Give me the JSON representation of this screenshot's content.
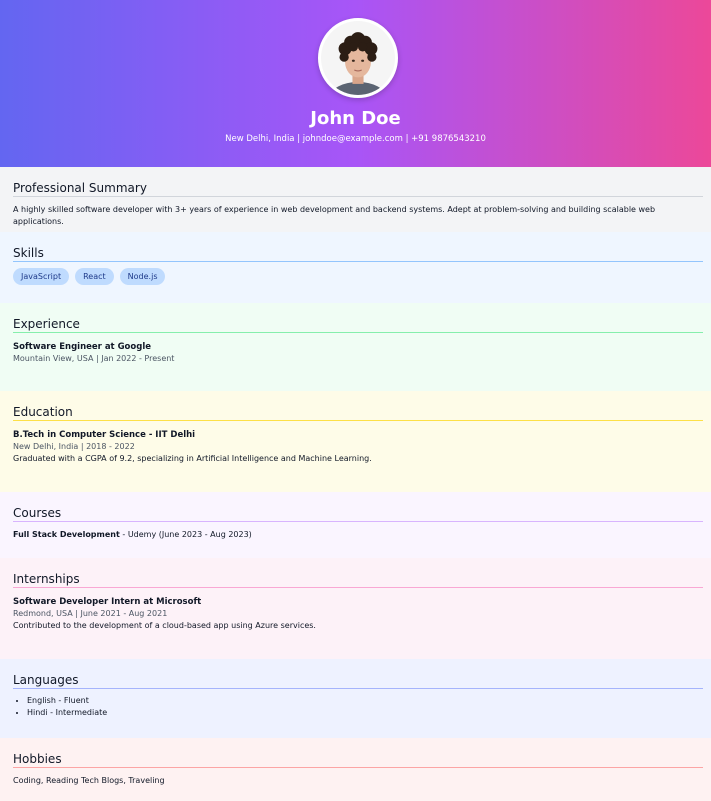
{
  "profile": {
    "name": "John Doe",
    "contact": "New Delhi, India | johndoe@example.com | +91 9876543210"
  },
  "summary": {
    "heading": "Professional Summary",
    "text": "A highly skilled software developer with 3+ years of experience in web development and backend systems. Adept at problem-solving and building scalable web applications."
  },
  "skills": {
    "heading": "Skills",
    "items": [
      "JavaScript",
      "React",
      "Node.js"
    ]
  },
  "experience": {
    "heading": "Experience",
    "title": "Software Engineer at Google",
    "meta": "Mountain View, USA | Jan 2022 - Present"
  },
  "education": {
    "heading": "Education",
    "title": "B.Tech in Computer Science - IIT Delhi",
    "meta": "New Delhi, India | 2018 - 2022",
    "detail": "Graduated with a CGPA of 9.2, specializing in Artificial Intelligence and Machine Learning."
  },
  "courses": {
    "heading": "Courses",
    "name": "Full Stack Development",
    "detail": "Udemy (June 2023 - Aug 2023)"
  },
  "internships": {
    "heading": "Internships",
    "title": "Software Developer Intern at Microsoft",
    "meta": "Redmond, USA | June 2021 - Aug 2021",
    "detail": "Contributed to the development of a cloud-based app using Azure services."
  },
  "languages": {
    "heading": "Languages",
    "items": [
      "English - Fluent",
      "Hindi - Intermediate"
    ]
  },
  "hobbies": {
    "heading": "Hobbies",
    "text": "Coding, Reading Tech Blogs, Traveling"
  },
  "colors": {
    "gradient_start": "#6366f1",
    "gradient_mid": "#a855f7",
    "gradient_end": "#ec4899",
    "chip_bg": "#bfdbfe"
  }
}
